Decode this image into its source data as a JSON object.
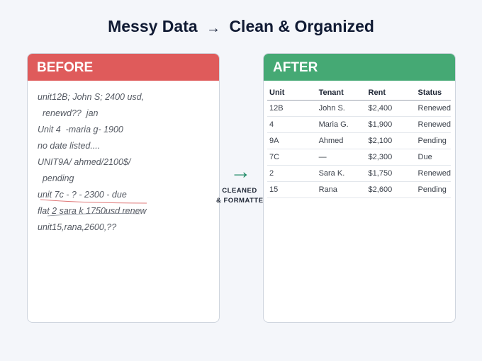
{
  "title": {
    "left": "Messy Data",
    "arrow": "→",
    "right": "Clean & Organized"
  },
  "before": {
    "heading": "BEFORE",
    "lines": [
      "unit12B; John S; 2400 usd,",
      "  renewd??  jan",
      "Unit 4  -maria g- 1900",
      "no date listed....",
      "UNIT9A/ ahmed/2100$/",
      "  pending",
      "unit 7c - ? - 2300 - due",
      "flat 2 sara k 1750usd renew",
      "unit15,rana,2600,??"
    ]
  },
  "flow": {
    "arrow": "→",
    "label_line1": "CLEANED",
    "label_line2": "& FORMATTED"
  },
  "after": {
    "heading": "AFTER",
    "columns": [
      "Unit",
      "Tenant",
      "Rent",
      "Status"
    ],
    "rows": [
      [
        "12B",
        "John S.",
        "$2,400",
        "Renewed"
      ],
      [
        "4",
        "Maria G.",
        "$1,900",
        "Renewed"
      ],
      [
        "9A",
        "Ahmed",
        "$2,100",
        "Pending"
      ],
      [
        "7C",
        "—",
        "$2,300",
        "Due"
      ],
      [
        "2",
        "Sara K.",
        "$1,750",
        "Renewed"
      ],
      [
        "15",
        "Rana",
        "$2,600",
        "Pending"
      ]
    ]
  },
  "colors": {
    "before_header": "#df5b5b",
    "after_header": "#45a974",
    "flow_arrow": "#1f8a66"
  }
}
